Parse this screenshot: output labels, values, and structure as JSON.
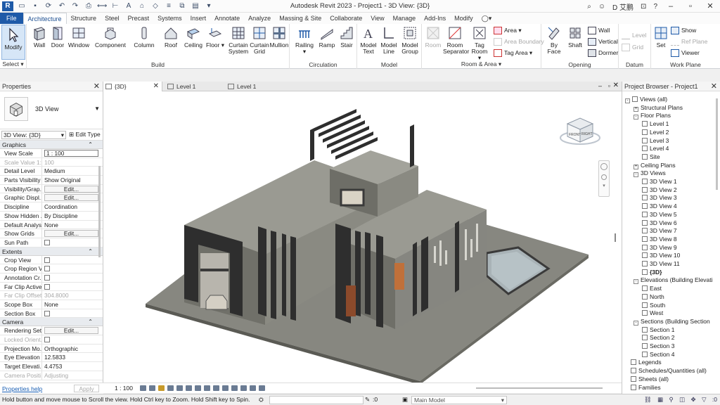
{
  "window": {
    "title": "Autodesk Revit 2023 - Project1 - 3D View: {3D}",
    "user": "D 艾鹏"
  },
  "ribbon_tabs": [
    "File",
    "Architecture",
    "Structure",
    "Steel",
    "Precast",
    "Systems",
    "Insert",
    "Annotate",
    "Analyze",
    "Massing & Site",
    "Collaborate",
    "View",
    "Manage",
    "Add-Ins",
    "Modify"
  ],
  "active_tab": "Architecture",
  "ribbon": {
    "select": {
      "modify": "Modify",
      "label": "Select"
    },
    "build": {
      "label": "Build",
      "wall": "Wall",
      "door": "Door",
      "window": "Window",
      "component": "Component",
      "column": "Column",
      "roof": "Roof",
      "ceiling": "Ceiling",
      "floor": "Floor",
      "curtain_system": "Curtain System",
      "curtain_grid": "Curtain Grid",
      "mullion": "Mullion"
    },
    "circulation": {
      "label": "Circulation",
      "railing": "Railing",
      "ramp": "Ramp",
      "stair": "Stair"
    },
    "model": {
      "label": "Model",
      "model_text": "Model Text",
      "model_line": "Model Line",
      "model_group": "Model Group"
    },
    "room_area": {
      "label": "Room & Area",
      "room": "Room",
      "room_separator": "Room Separator",
      "tag_room": "Tag Room",
      "area": "Area",
      "area_boundary": "Area Boundary",
      "tag_area": "Tag Area"
    },
    "opening": {
      "label": "Opening",
      "by_face": "By Face",
      "shaft": "Shaft",
      "wall": "Wall",
      "vertical": "Vertical",
      "dormer": "Dormer"
    },
    "datum": {
      "label": "Datum",
      "level": "Level",
      "grid": "Grid"
    },
    "work_plane": {
      "label": "Work Plane",
      "set": "Set",
      "show": "Show",
      "ref_plane": "Ref Plane",
      "viewer": "Viewer"
    }
  },
  "properties": {
    "title": "Properties",
    "type_name": "3D View",
    "view_select": "3D View: {3D}",
    "edit_type": "Edit Type",
    "categories": {
      "graphics": "Graphics",
      "extents": "Extents",
      "camera": "Camera"
    },
    "graphics_rows": [
      {
        "key": "View Scale",
        "value": "1 : 100"
      },
      {
        "key": "Scale Value    1:",
        "value": "100"
      },
      {
        "key": "Detail Level",
        "value": "Medium"
      },
      {
        "key": "Parts Visibility",
        "value": "Show Original"
      },
      {
        "key": "Visibility/Grap...",
        "value": "Edit..."
      },
      {
        "key": "Graphic Displ...",
        "value": "Edit..."
      },
      {
        "key": "Discipline",
        "value": "Coordination"
      },
      {
        "key": "Show Hidden ...",
        "value": "By Discipline"
      },
      {
        "key": "Default Analys...",
        "value": "None"
      },
      {
        "key": "Show Grids",
        "value": "Edit..."
      },
      {
        "key": "Sun Path",
        "value": ""
      }
    ],
    "extents_rows": [
      {
        "key": "Crop View",
        "value": ""
      },
      {
        "key": "Crop Region V...",
        "value": ""
      },
      {
        "key": "Annotation Cr...",
        "value": ""
      },
      {
        "key": "Far Clip Active",
        "value": ""
      },
      {
        "key": "Far Clip Offset",
        "value": "304.8000"
      },
      {
        "key": "Scope Box",
        "value": "None"
      },
      {
        "key": "Section Box",
        "value": ""
      }
    ],
    "camera_rows": [
      {
        "key": "Rendering Set...",
        "value": "Edit..."
      },
      {
        "key": "Locked Orient...",
        "value": ""
      },
      {
        "key": "Projection Mo...",
        "value": "Orthographic"
      },
      {
        "key": "Eye Elevation",
        "value": "12.5833"
      },
      {
        "key": "Target Elevati...",
        "value": "4.4753"
      },
      {
        "key": "Camera Positi...",
        "value": "Adjusting"
      }
    ],
    "help": "Properties help",
    "apply": "Apply"
  },
  "view_tabs": [
    "{3D}",
    "Level 1",
    "Level 1"
  ],
  "view_bar": {
    "scale": "1 : 100"
  },
  "viewcube": {
    "front": "FRONT",
    "right": "RIGHT"
  },
  "browser": {
    "title": "Project Browser - Project1",
    "nodes": [
      {
        "label": "Views (all)",
        "depth": 0,
        "toggle": "-"
      },
      {
        "label": "Structural Plans",
        "depth": 1,
        "toggle": "+"
      },
      {
        "label": "Floor Plans",
        "depth": 1,
        "toggle": "-"
      },
      {
        "label": "Level 1",
        "depth": 2
      },
      {
        "label": "Level 2",
        "depth": 2
      },
      {
        "label": "Level 3",
        "depth": 2
      },
      {
        "label": "Level 4",
        "depth": 2
      },
      {
        "label": "Site",
        "depth": 2
      },
      {
        "label": "Ceiling Plans",
        "depth": 1,
        "toggle": "+"
      },
      {
        "label": "3D Views",
        "depth": 1,
        "toggle": "-"
      },
      {
        "label": "3D View 1",
        "depth": 2
      },
      {
        "label": "3D View 2",
        "depth": 2
      },
      {
        "label": "3D View 3",
        "depth": 2
      },
      {
        "label": "3D View 4",
        "depth": 2
      },
      {
        "label": "3D View 5",
        "depth": 2
      },
      {
        "label": "3D View 6",
        "depth": 2
      },
      {
        "label": "3D View 7",
        "depth": 2
      },
      {
        "label": "3D View 8",
        "depth": 2
      },
      {
        "label": "3D View 9",
        "depth": 2
      },
      {
        "label": "3D View 10",
        "depth": 2
      },
      {
        "label": "3D View 11",
        "depth": 2
      },
      {
        "label": "{3D}",
        "depth": 2,
        "selected": true
      },
      {
        "label": "Elevations (Building Elevati",
        "depth": 1,
        "toggle": "-"
      },
      {
        "label": "East",
        "depth": 2
      },
      {
        "label": "North",
        "depth": 2
      },
      {
        "label": "South",
        "depth": 2
      },
      {
        "label": "West",
        "depth": 2
      },
      {
        "label": "Sections (Building Section",
        "depth": 1,
        "toggle": "-"
      },
      {
        "label": "Section 1",
        "depth": 2
      },
      {
        "label": "Section 2",
        "depth": 2
      },
      {
        "label": "Section 3",
        "depth": 2
      },
      {
        "label": "Section 4",
        "depth": 2
      },
      {
        "label": "Legends",
        "depth": 0
      },
      {
        "label": "Schedules/Quantities (all)",
        "depth": 0
      },
      {
        "label": "Sheets (all)",
        "depth": 0
      },
      {
        "label": "Families",
        "depth": 0
      }
    ]
  },
  "status": {
    "text": "Hold button and move mouse to Scroll the view. Hold Ctrl key to Zoom. Hold Shift key to Spin.",
    "zero": ":0",
    "workset": "Main Model"
  },
  "colors": {
    "accent": "#1e5aa8",
    "model": "#8a8a80",
    "ground": "#7b7b72",
    "dark_panel": "#2e2e2e"
  }
}
